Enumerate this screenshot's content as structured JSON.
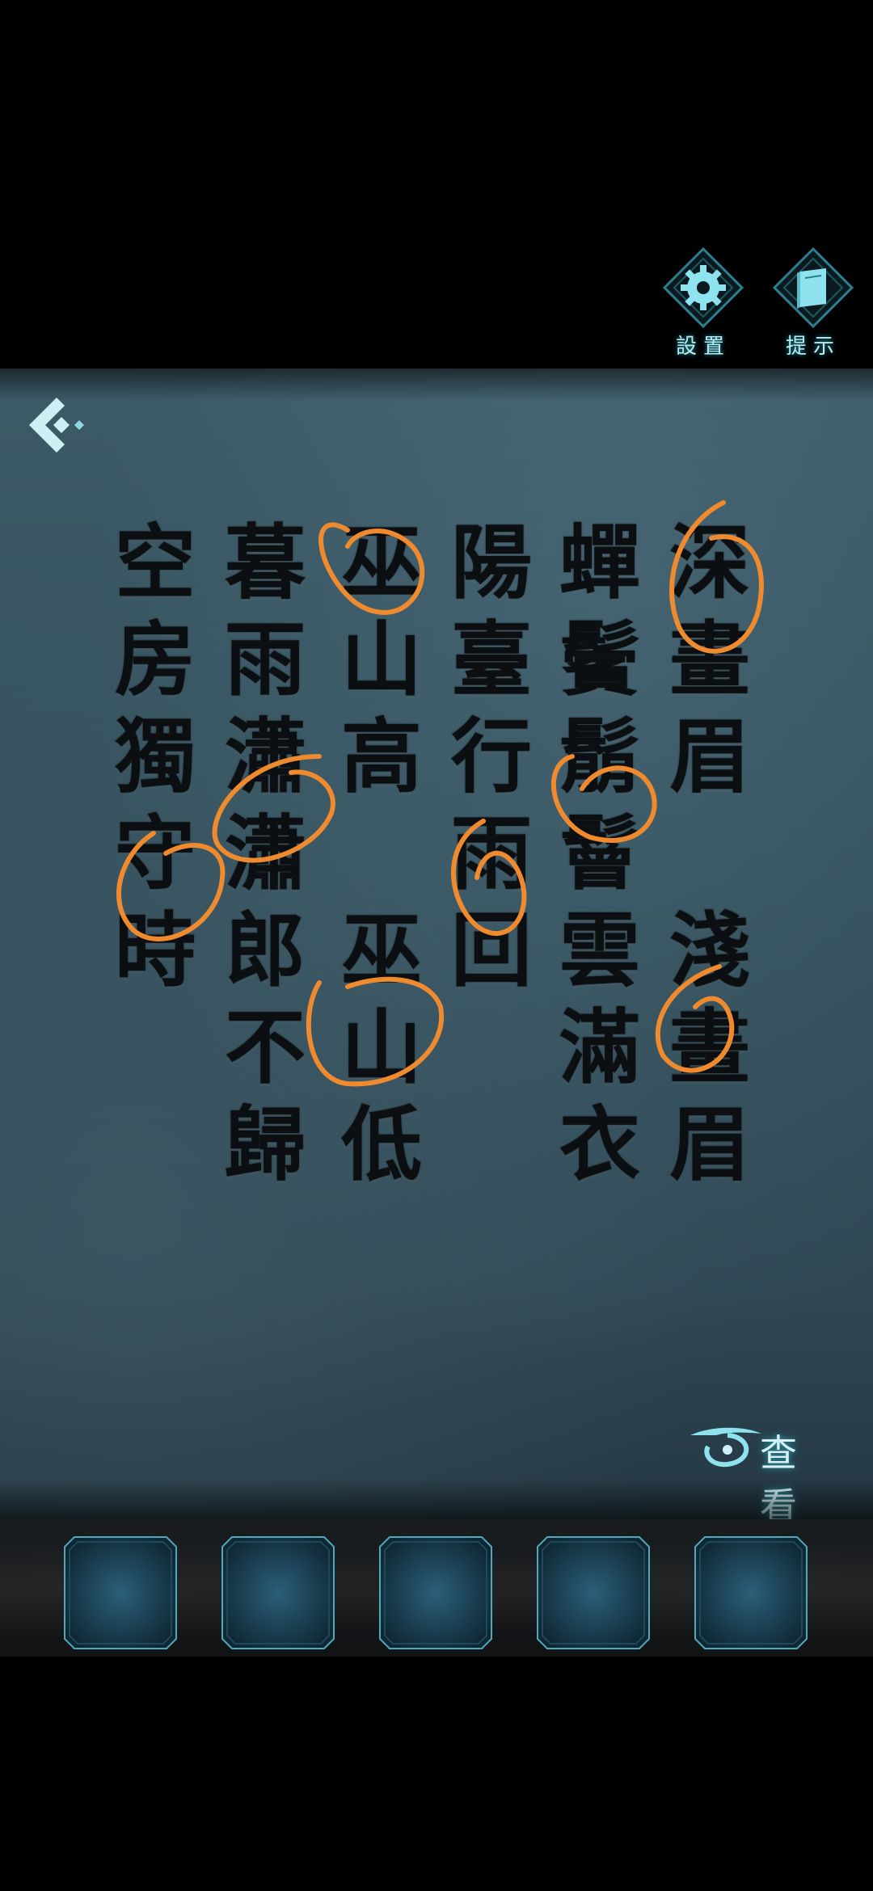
{
  "hud": {
    "settings_label": "設置",
    "hint_label": "提示"
  },
  "poem": {
    "columns": [
      [
        "深",
        "畫",
        "眉",
        "",
        "淺",
        "畫",
        "眉"
      ],
      [
        "蟬",
        "鬢",
        "鬅",
        "鬙",
        "雲",
        "滿",
        "衣"
      ],
      [
        "陽",
        "臺",
        "行",
        "雨",
        "回"
      ],
      [
        "巫",
        "山",
        "高",
        "",
        "巫",
        "山",
        "低"
      ],
      [
        "暮",
        "雨",
        "瀟",
        "瀟",
        "郎",
        "不",
        "歸"
      ],
      [
        "空",
        "房",
        "獨",
        "守",
        "時"
      ]
    ]
  },
  "annotation_color": "#f08a2e",
  "view_button": {
    "label": "查看"
  },
  "inventory": {
    "slot_count": 5
  },
  "colors": {
    "accent": "#2aa7b8",
    "ink": "#0c0f11",
    "scene_bg": "#34505d"
  }
}
